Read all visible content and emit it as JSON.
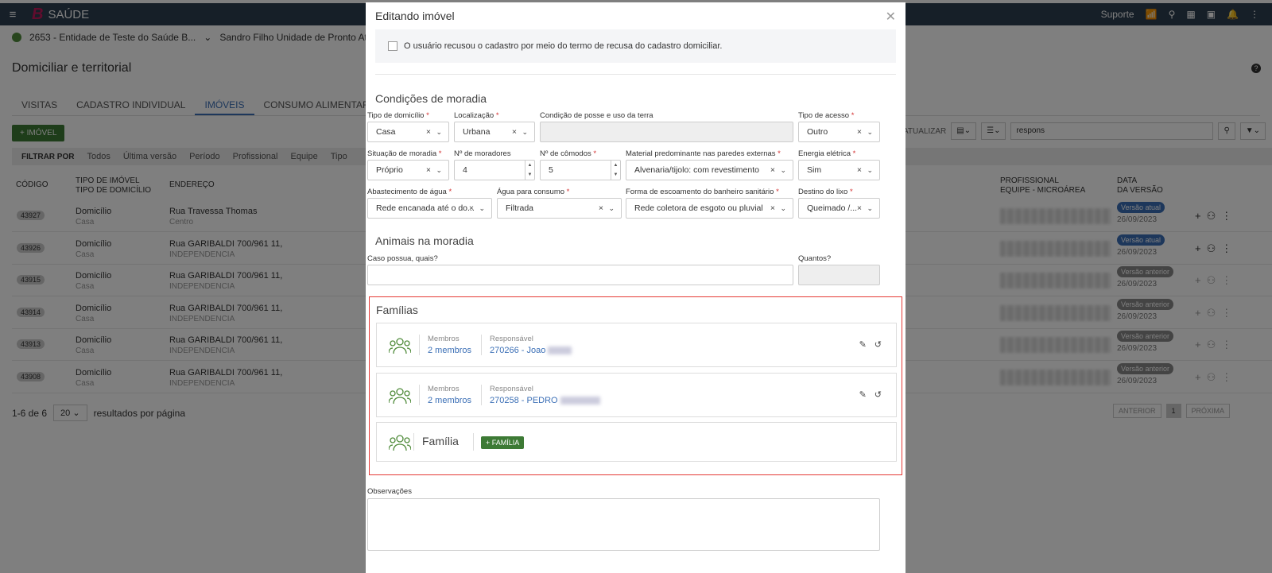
{
  "topbar": {
    "menu_icon": "hamburger-icon",
    "brand": "B",
    "app_name": "SAÚDE",
    "support": "Suporte"
  },
  "context": {
    "entity": "2653 - Entidade de Teste do Saúde B...",
    "unit": "Sandro Filho Unidade de Pronto Atendi..."
  },
  "page": {
    "title": "Domiciliar e territorial"
  },
  "tabs": [
    {
      "label": "VISITAS"
    },
    {
      "label": "CADASTRO INDIVIDUAL"
    },
    {
      "label": "IMÓVEIS"
    },
    {
      "label": "CONSUMO ALIMENTAR"
    }
  ],
  "add_button": "+ IMÓVEL",
  "filters": {
    "label": "FILTRAR POR",
    "items": [
      "Todos",
      "Última versão",
      "Período",
      "Profissional",
      "Equipe",
      "Tipo"
    ]
  },
  "toolbar": {
    "update": "ATUALIZAR",
    "search_value": "respons"
  },
  "table": {
    "headers": {
      "code": "CÓDIGO",
      "type1": "TIPO DE IMÓVEL",
      "type2": "TIPO DE DOMICÍLIO",
      "address": "ENDEREÇO",
      "prof1": "PROFISSIONAL",
      "prof2": "EQUIPE - MICROÁREA",
      "date1": "DATA",
      "date2": "DA VERSÃO"
    },
    "rows": [
      {
        "code": "43927",
        "type": "Domicílio",
        "subtype": "Casa",
        "address": "Rua Travessa Thomas",
        "district": "Centro",
        "version": "Versão atual",
        "date": "26/09/2023",
        "current": true
      },
      {
        "code": "43926",
        "type": "Domicílio",
        "subtype": "Casa",
        "address": "Rua GARIBALDI 700/961 11,",
        "district": "INDEPENDENCIA",
        "version": "Versão atual",
        "date": "26/09/2023",
        "current": true
      },
      {
        "code": "43915",
        "type": "Domicílio",
        "subtype": "Casa",
        "address": "Rua GARIBALDI 700/961 11,",
        "district": "INDEPENDENCIA",
        "version": "Versão anterior",
        "date": "26/09/2023",
        "current": false
      },
      {
        "code": "43914",
        "type": "Domicílio",
        "subtype": "Casa",
        "address": "Rua GARIBALDI 700/961 11,",
        "district": "INDEPENDENCIA",
        "version": "Versão anterior",
        "date": "26/09/2023",
        "current": false
      },
      {
        "code": "43913",
        "type": "Domicílio",
        "subtype": "Casa",
        "address": "Rua GARIBALDI 700/961 11,",
        "district": "INDEPENDENCIA",
        "version": "Versão anterior",
        "date": "26/09/2023",
        "current": false
      },
      {
        "code": "43908",
        "type": "Domicílio",
        "subtype": "Casa",
        "address": "Rua GARIBALDI 700/961 11,",
        "district": "INDEPENDENCIA",
        "version": "Versão anterior",
        "date": "26/09/2023",
        "current": false
      }
    ]
  },
  "pagination": {
    "range": "1-6 de 6",
    "per_page": "20",
    "per_page_label": "resultados por página",
    "prev": "ANTERIOR",
    "current": "1",
    "next": "PRÓXIMA"
  },
  "modal": {
    "title": "Editando imóvel",
    "refusal_text": "O usuário recusou o cadastro por meio do termo de recusa do cadastro domiciliar.",
    "housing_title": "Condições de moradia",
    "fields": {
      "tipo_domicilio": {
        "label": "Tipo de domicílio",
        "value": "Casa"
      },
      "localizacao": {
        "label": "Localização",
        "value": "Urbana"
      },
      "posse": {
        "label": "Condição de posse e uso da terra",
        "value": ""
      },
      "tipo_acesso": {
        "label": "Tipo de acesso",
        "value": "Outro"
      },
      "situacao": {
        "label": "Situação de moradia",
        "value": "Próprio"
      },
      "moradores": {
        "label": "Nº de moradores",
        "value": "4"
      },
      "comodos": {
        "label": "Nº de cômodos",
        "value": "5"
      },
      "material": {
        "label": "Material predominante nas paredes externas",
        "value": "Alvenaria/tijolo: com revestimento"
      },
      "energia": {
        "label": "Energia elétrica",
        "value": "Sim"
      },
      "agua": {
        "label": "Abastecimento de água",
        "value": "Rede encanada até o do..."
      },
      "agua_consumo": {
        "label": "Água para consumo",
        "value": "Filtrada"
      },
      "escoamento": {
        "label": "Forma de escoamento do banheiro sanitário",
        "value": "Rede coletora de esgoto ou pluvial"
      },
      "lixo": {
        "label": "Destino do lixo",
        "value": "Queimado /..."
      }
    },
    "animals_title": "Animais na moradia",
    "animals_label": "Caso possua, quais?",
    "animals_qty_label": "Quantos?",
    "families_title": "Famílias",
    "families": [
      {
        "members_label": "Membros",
        "members": "2 membros",
        "resp_label": "Responsável",
        "resp": "270266 - Joao"
      },
      {
        "members_label": "Membros",
        "members": "2 membros",
        "resp_label": "Responsável",
        "resp": "270258 - PEDRO"
      }
    ],
    "new_family_label": "Família",
    "add_family": "+ FAMÍLIA",
    "obs_label": "Observações"
  },
  "colors": {
    "topbar": "#2d3e50",
    "accent": "#3b6fb6",
    "green": "#3d7a35",
    "highlight": "#e53935"
  }
}
